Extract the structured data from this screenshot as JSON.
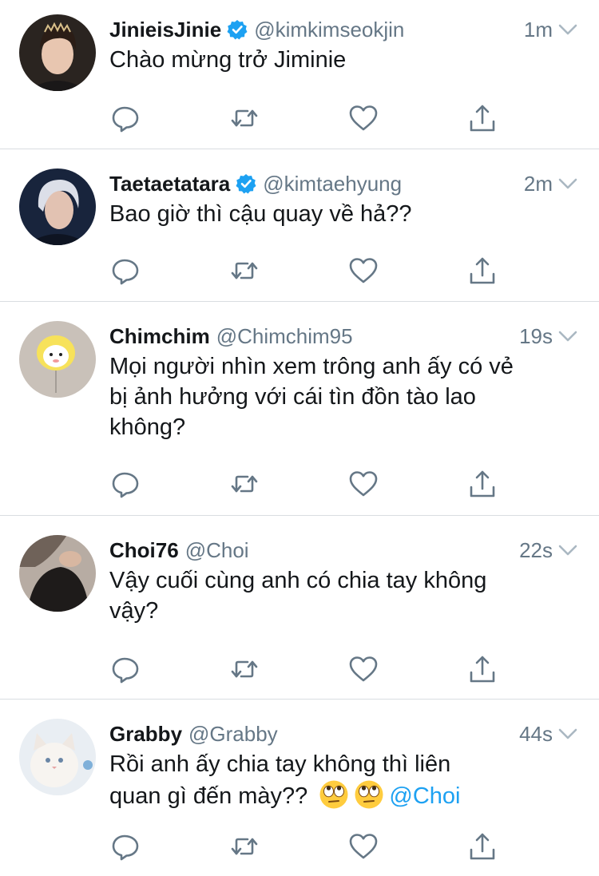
{
  "tweets": [
    {
      "display_name": "JinieisJinie",
      "verified": true,
      "handle": "@kimkimseokjin",
      "time": "1m",
      "text_lines": [
        "Chào mừng trở Jiminie"
      ],
      "avatar": "avatar-photo-jin"
    },
    {
      "display_name": "Taetaetatara",
      "verified": true,
      "handle": "@kimtaehyung",
      "time": "2m",
      "text_lines": [
        "Bao giờ thì cậu quay về hả??"
      ],
      "avatar": "avatar-photo-taehyung"
    },
    {
      "display_name": "Chimchim",
      "verified": false,
      "handle": "@Chimchim95",
      "time": "19s",
      "text_lines": [
        "Mọi người nhìn xem trông anh ấy có vẻ",
        "bị ảnh hưởng với cái tìn đồn tào lao",
        "không?"
      ],
      "avatar": "avatar-yellow-balloon"
    },
    {
      "display_name": "Choi76",
      "verified": false,
      "handle": "@Choi",
      "time": "22s",
      "text_lines": [
        "Vậy cuối cùng anh có chia tay không",
        "vậy?"
      ],
      "avatar": "avatar-dark-photo"
    },
    {
      "display_name": "Grabby",
      "verified": false,
      "handle": "@Grabby",
      "time": "44s",
      "text_lines": [
        "Rồi anh ấy chia tay không thì liên",
        "quan gì đến mày??"
      ],
      "emojis": [
        "eye-roll-emoji",
        "eye-roll-emoji"
      ],
      "mention": "@Choi",
      "avatar": "avatar-white-cat"
    }
  ],
  "icons": {
    "reply": "reply-icon",
    "retweet": "retweet-icon",
    "like": "like-icon",
    "share": "share-icon",
    "verified": "verified-badge-icon",
    "more": "chevron-down-icon"
  },
  "colors": {
    "text": "#14171a",
    "secondary": "#657786",
    "verified": "#1da1f2",
    "mention": "#1da1f2",
    "divider": "#d9dde1",
    "action_icon": "#657786"
  }
}
